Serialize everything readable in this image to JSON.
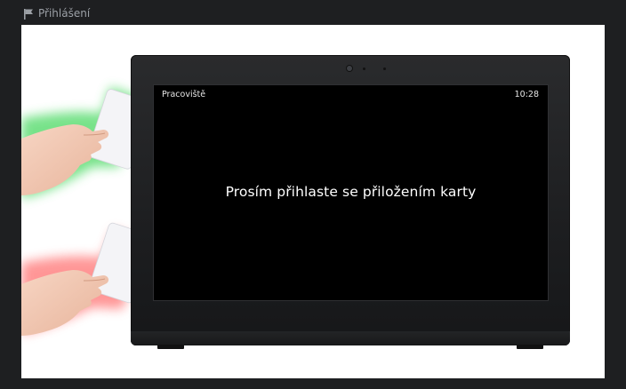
{
  "header": {
    "title": "Přihlášení",
    "icon": "flag-icon"
  },
  "device_screen": {
    "workplace_label": "Pracoviště",
    "time": "10:28",
    "message": "Prosím přihlaste se přiložením karty"
  },
  "illustration": {
    "top_hand_glow_color": "#4cd964",
    "bottom_hand_glow_color": "#ff6b6b"
  }
}
